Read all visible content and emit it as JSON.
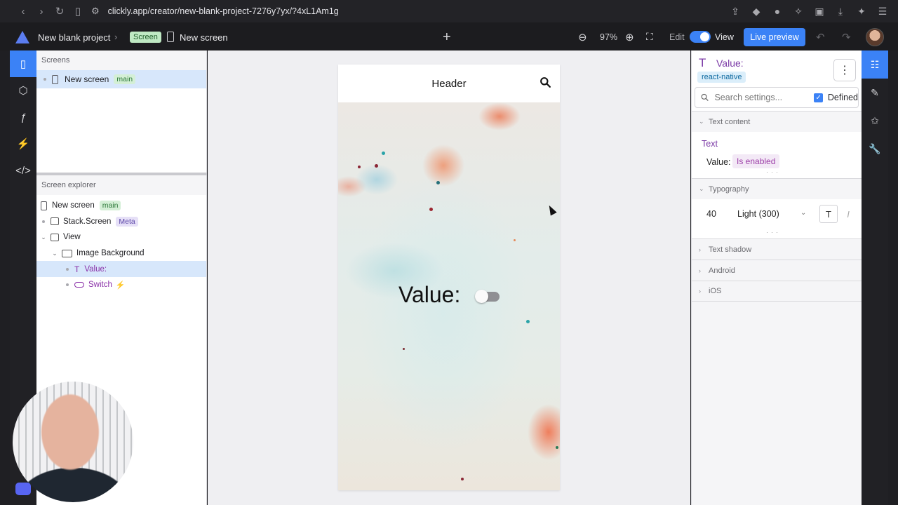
{
  "browser": {
    "url": "clickly.app/creator/new-blank-project-7276y7yx/?4xL1Am1g"
  },
  "header": {
    "project_name": "New blank project",
    "crumb_badge": "Screen",
    "screen_name": "New screen",
    "zoom": "97%",
    "edit_label": "Edit",
    "view_label": "View",
    "live_preview": "Live preview"
  },
  "screens_panel": {
    "title": "Screens",
    "items": [
      {
        "label": "New screen",
        "tag": "main"
      }
    ]
  },
  "explorer": {
    "title": "Screen explorer",
    "rows": [
      {
        "label": "New screen",
        "tag": "main"
      },
      {
        "label": "Stack.Screen",
        "tag": "Meta"
      },
      {
        "label": "View"
      },
      {
        "label": "Image Background"
      },
      {
        "label": "Value:"
      },
      {
        "label": "Switch"
      }
    ]
  },
  "phone": {
    "header_title": "Header",
    "value_text": "Value:"
  },
  "inspector": {
    "title": "Value:",
    "platform": "react-native",
    "search_placeholder": "Search settings...",
    "defined_label": "Defined",
    "sections": {
      "text_content": "Text content",
      "typography": "Typography",
      "text_shadow": "Text shadow",
      "android": "Android",
      "ios": "iOS"
    },
    "text_label": "Text",
    "value_label": "Value:",
    "value_binding": "Is enabled",
    "font_size": "40",
    "font_weight": "Light (300)"
  },
  "colors": {
    "accent": "#3b82f6",
    "rail": "#212125",
    "purple": "#7b3aa6"
  }
}
